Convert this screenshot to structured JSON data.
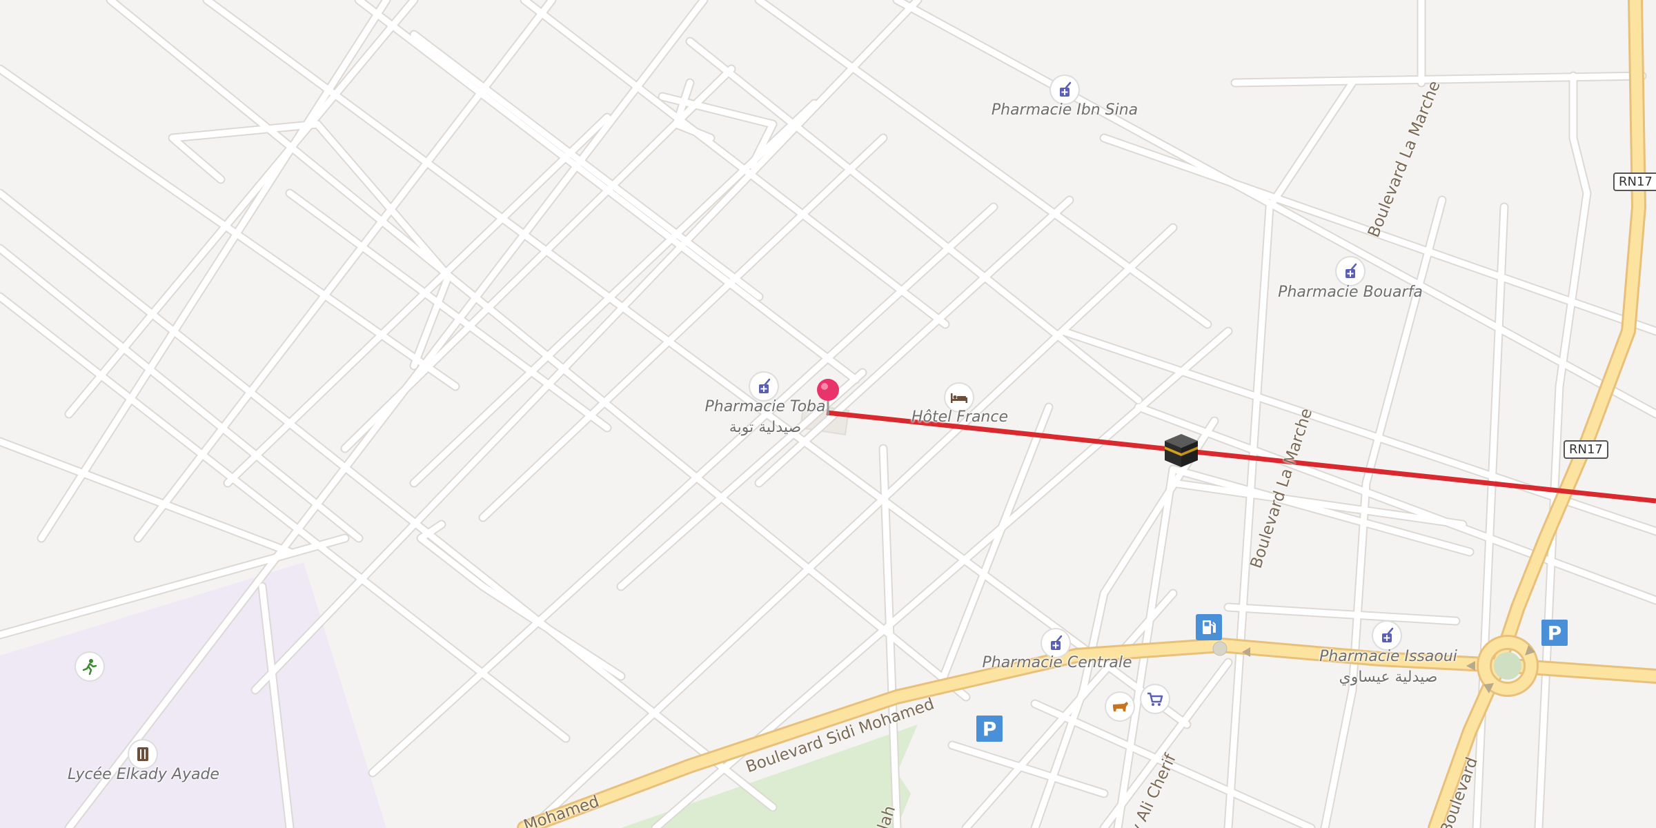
{
  "pois": {
    "pharmacie_ibn_sina": "Pharmacie Ibn Sina",
    "pharmacie_bouarfa": "Pharmacie Bouarfa",
    "pharmacie_toba": "Pharmacie Toba",
    "pharmacie_toba_ar": "صيدلية توبة",
    "hotel_france": "Hôtel France",
    "pharmacie_centrale": "Pharmacie Centrale",
    "pharmacie_issaoui": "Pharmacie Issaoui",
    "pharmacie_issaoui_ar": "صيدلية عيساوي",
    "lycee": "Lycée Elkady Ayade"
  },
  "streets": {
    "bd_la_marche_top": "Boulevard La Marche",
    "bd_la_marche_mid": "Boulevard La Marche",
    "bd_sidi_mohamed": "Boulevard Sidi Mohamed",
    "mohamed_partial": "Mohamed",
    "ali_cherif": "y Ali Cherif",
    "ilah_partial": "llah",
    "boulevard_partial": "Boulevard"
  },
  "shields": {
    "rn17_top": "RN17",
    "rn17_mid": "RN17"
  },
  "parking_label": "P",
  "colors": {
    "background": "#f5f3f1",
    "road": "#ffffff",
    "road_casing": "#dcd8d4",
    "primary_road": "#fce3a0",
    "primary_casing": "#e8c079",
    "qibla_line": "#d9282e",
    "school_area": "#efe9f6",
    "park_area": "#dcecd0",
    "pin": "#e8336b",
    "pharmacy_icon": "#5a5fb5"
  },
  "icons": {
    "pin": "location-pin-icon",
    "kaaba": "kaaba-icon",
    "pharmacy": "pharmacy-icon",
    "hotel": "hotel-bed-icon",
    "fuel": "fuel-station-icon",
    "parking": "parking-icon",
    "supermarket": "shopping-cart-icon",
    "butcher": "butcher-cow-icon",
    "sports": "sports-runner-icon",
    "school": "school-icon"
  }
}
